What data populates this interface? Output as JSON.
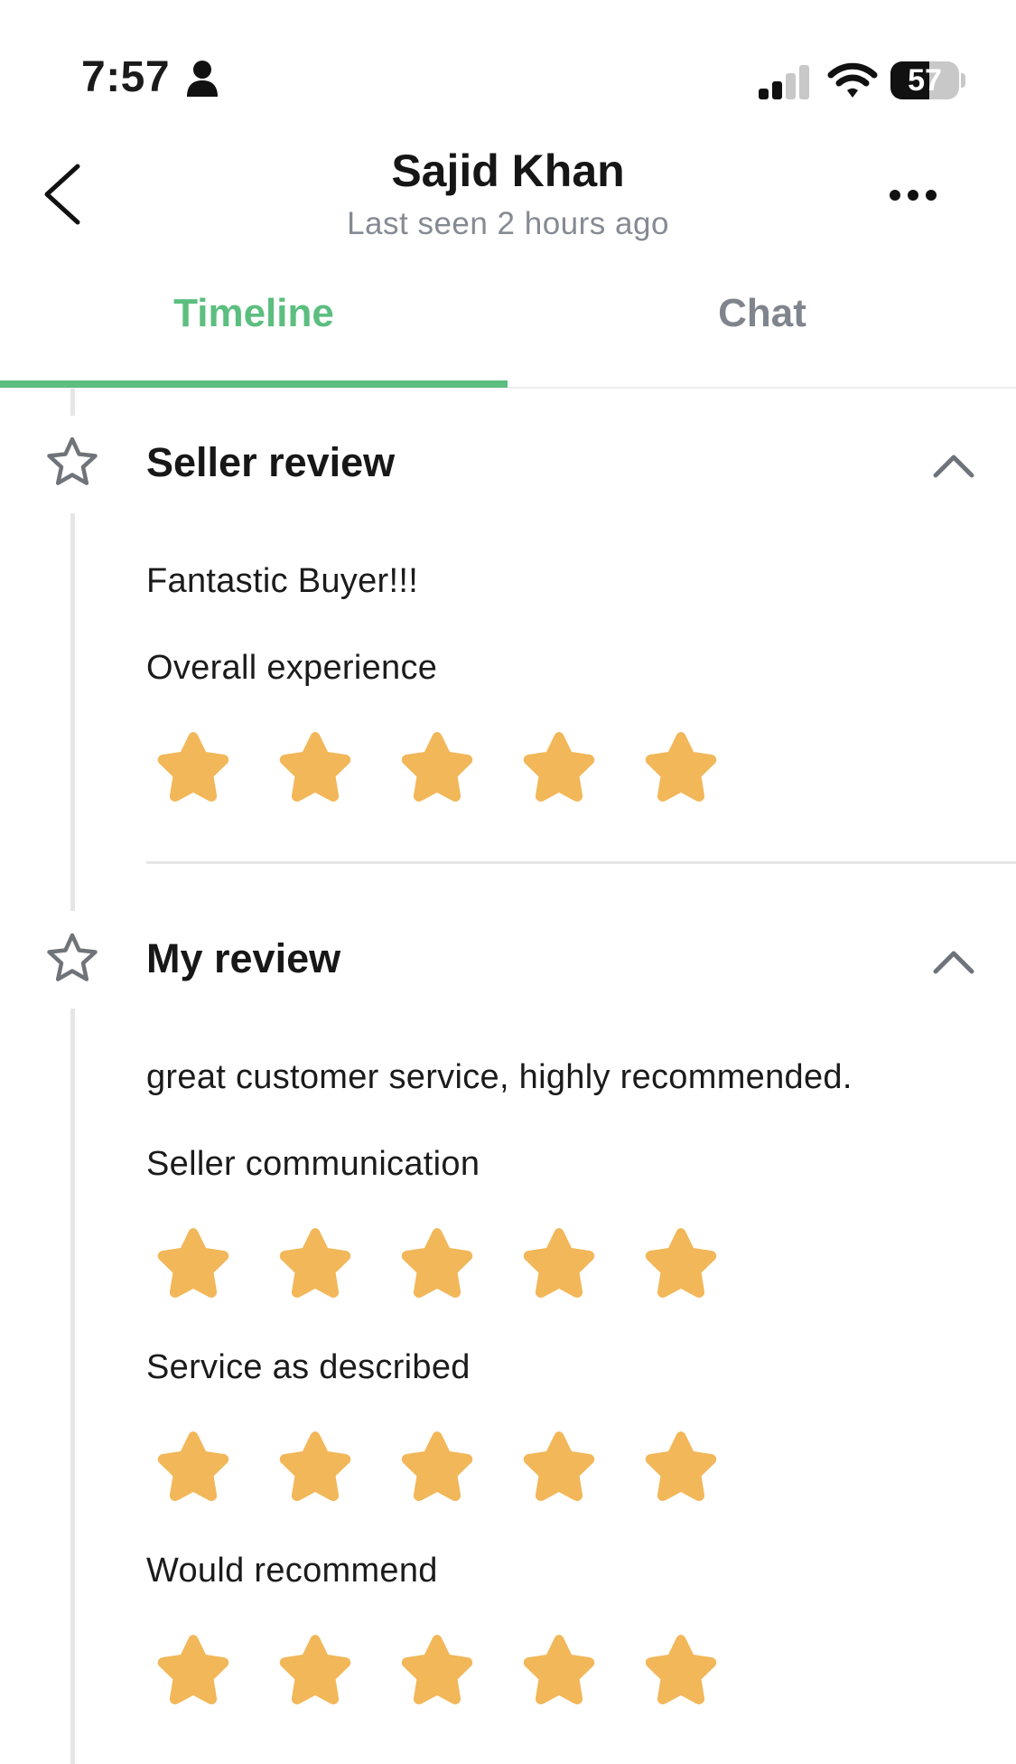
{
  "status_bar": {
    "time": "7:57",
    "battery": "57",
    "battery_level": 0.57
  },
  "header": {
    "name": "Sajid Khan",
    "last_seen": "Last seen 2 hours ago"
  },
  "tabs": [
    {
      "label": "Timeline",
      "active": true
    },
    {
      "label": "Chat",
      "active": false
    }
  ],
  "seller_review": {
    "title": "Seller review",
    "comment": "Fantastic Buyer!!!",
    "ratings": [
      {
        "label": "Overall experience",
        "stars": 5,
        "max": 5
      }
    ]
  },
  "my_review": {
    "title": "My review",
    "comment": "great customer service, highly recommended.",
    "ratings": [
      {
        "label": "Seller communication",
        "stars": 5,
        "max": 5
      },
      {
        "label": "Service as described",
        "stars": 5,
        "max": 5
      },
      {
        "label": "Would recommend",
        "stars": 5,
        "max": 5
      }
    ]
  },
  "colors": {
    "accent": "#5cbe7f",
    "star": "#f2b759",
    "muted_text": "#858a93",
    "divider": "#e6e6e6"
  },
  "icons": {
    "back": "chevron-left-icon",
    "more": "ellipsis-icon",
    "section": "star-outline-icon",
    "collapse": "chevron-up-icon",
    "rating": "star-filled-icon"
  }
}
